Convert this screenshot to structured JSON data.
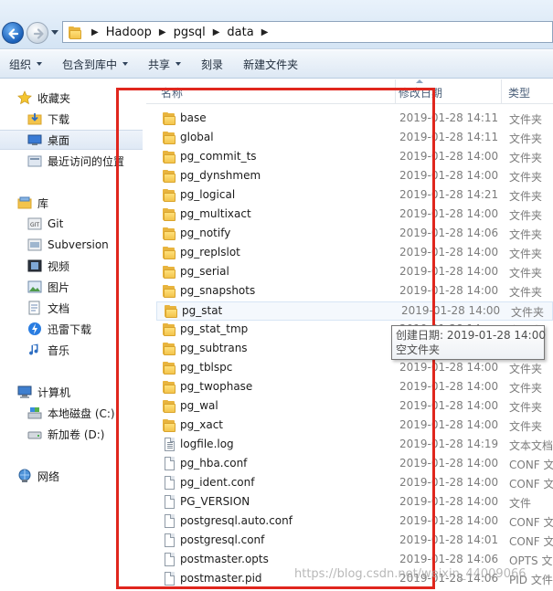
{
  "address_bar": {
    "crumbs": [
      "Hadoop",
      "pgsql",
      "data"
    ]
  },
  "toolbar": {
    "organize": "组织",
    "include_in_library": "包含到库中",
    "share": "共享",
    "burn": "刻录",
    "new_folder": "新建文件夹"
  },
  "nav": {
    "favorites": "收藏夹",
    "downloads": "下载",
    "desktop": "桌面",
    "recent": "最近访问的位置",
    "libraries": "库",
    "git": "Git",
    "subversion": "Subversion",
    "videos": "视频",
    "pictures": "图片",
    "documents": "文档",
    "thunder": "迅雷下载",
    "music": "音乐",
    "computer": "计算机",
    "local_disk": "本地磁盘 (C:)",
    "new_volume": "新加卷 (D:)",
    "network": "网络"
  },
  "columns": {
    "name": "名称",
    "modified": "修改日期",
    "type": "类型"
  },
  "files": [
    {
      "name": "base",
      "date": "2019-01-28 14:11",
      "type": "文件夹",
      "icon": "folder-icon"
    },
    {
      "name": "global",
      "date": "2019-01-28 14:11",
      "type": "文件夹",
      "icon": "folder-icon"
    },
    {
      "name": "pg_commit_ts",
      "date": "2019-01-28 14:00",
      "type": "文件夹",
      "icon": "folder-icon"
    },
    {
      "name": "pg_dynshmem",
      "date": "2019-01-28 14:00",
      "type": "文件夹",
      "icon": "folder-icon"
    },
    {
      "name": "pg_logical",
      "date": "2019-01-28 14:21",
      "type": "文件夹",
      "icon": "folder-icon"
    },
    {
      "name": "pg_multixact",
      "date": "2019-01-28 14:00",
      "type": "文件夹",
      "icon": "folder-icon"
    },
    {
      "name": "pg_notify",
      "date": "2019-01-28 14:06",
      "type": "文件夹",
      "icon": "folder-icon"
    },
    {
      "name": "pg_replslot",
      "date": "2019-01-28 14:00",
      "type": "文件夹",
      "icon": "folder-icon"
    },
    {
      "name": "pg_serial",
      "date": "2019-01-28 14:00",
      "type": "文件夹",
      "icon": "folder-icon"
    },
    {
      "name": "pg_snapshots",
      "date": "2019-01-28 14:00",
      "type": "文件夹",
      "icon": "folder-icon"
    },
    {
      "name": "pg_stat",
      "date": "2019-01-28 14:00",
      "type": "文件夹",
      "icon": "folder-icon"
    },
    {
      "name": "pg_stat_tmp",
      "date": "2019-01-28 14:",
      "type": "文件夹",
      "icon": "folder-icon"
    },
    {
      "name": "pg_subtrans",
      "date": "2019-01-28 14:00",
      "type": "文件夹",
      "icon": "folder-icon"
    },
    {
      "name": "pg_tblspc",
      "date": "2019-01-28 14:00",
      "type": "文件夹",
      "icon": "folder-icon"
    },
    {
      "name": "pg_twophase",
      "date": "2019-01-28 14:00",
      "type": "文件夹",
      "icon": "folder-icon"
    },
    {
      "name": "pg_wal",
      "date": "2019-01-28 14:00",
      "type": "文件夹",
      "icon": "folder-icon"
    },
    {
      "name": "pg_xact",
      "date": "2019-01-28 14:00",
      "type": "文件夹",
      "icon": "folder-icon"
    },
    {
      "name": "logfile.log",
      "date": "2019-01-28 14:19",
      "type": "文本文档",
      "icon": "text-file-icon"
    },
    {
      "name": "pg_hba.conf",
      "date": "2019-01-28 14:00",
      "type": "CONF 文",
      "icon": "file-icon"
    },
    {
      "name": "pg_ident.conf",
      "date": "2019-01-28 14:00",
      "type": "CONF 文",
      "icon": "file-icon"
    },
    {
      "name": "PG_VERSION",
      "date": "2019-01-28 14:00",
      "type": "文件",
      "icon": "file-icon"
    },
    {
      "name": "postgresql.auto.conf",
      "date": "2019-01-28 14:00",
      "type": "CONF 文",
      "icon": "file-icon"
    },
    {
      "name": "postgresql.conf",
      "date": "2019-01-28 14:01",
      "type": "CONF 文",
      "icon": "file-icon"
    },
    {
      "name": "postmaster.opts",
      "date": "2019-01-28 14:06",
      "type": "OPTS 文",
      "icon": "file-icon"
    },
    {
      "name": "postmaster.pid",
      "date": "2019-01-28 14:06",
      "type": "PID 文件",
      "icon": "file-icon"
    }
  ],
  "tooltip": {
    "line1": "创建日期: 2019-01-28 14:00",
    "line2": "空文件夹"
  },
  "watermark": "https://blog.csdn.net/weixin_44009066",
  "colors": {
    "highlight_box": "#e0261d",
    "folder": "#f3c44c",
    "selection": "#dfe9f5"
  }
}
